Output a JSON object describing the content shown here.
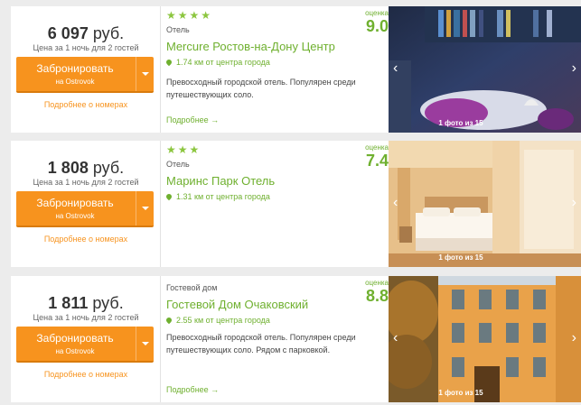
{
  "hotels": [
    {
      "price": "6 097",
      "currency": "руб.",
      "price_note": "Цена за 1 ночь для 2 гостей",
      "book_label": "Забронировать",
      "book_sub": "на Ostrovok",
      "rooms_link": "Подробнее о номерах",
      "stars": "★★★★",
      "type": "Отель",
      "name": "Mercure Ростов-на-Дону Центр",
      "distance": "1.74 км от центра города",
      "description": "Превосходный городской отель. Популярен среди путешествующих соло.",
      "more": "Подробнее →",
      "rating_label": "оценка",
      "rating": "9.0",
      "photo_count": "1 фото из 15"
    },
    {
      "price": "1 808",
      "currency": "руб.",
      "price_note": "Цена за 1 ночь для 2 гостей",
      "book_label": "Забронировать",
      "book_sub": "на Ostrovok",
      "rooms_link": "Подробнее о номерах",
      "stars": "★★★",
      "type": "Отель",
      "name": "Маринс Парк Отель",
      "distance": "1.31 км от центра города",
      "description": "",
      "more": "",
      "rating_label": "оценка",
      "rating": "7.4",
      "photo_count": "1 фото из 15"
    },
    {
      "price": "1 811",
      "currency": "руб.",
      "price_note": "Цена за 1 ночь для 2 гостей",
      "book_label": "Забронировать",
      "book_sub": "на Ostrovok",
      "rooms_link": "Подробнее о номерах",
      "stars": "",
      "type": "Гостевой дом",
      "name": "Гостевой Дом Очаковский",
      "distance": "2.55 км от центра города",
      "description": "Превосходный городской отель. Популярен среди путешествующих соло. Рядом с парковкой.",
      "more": "Подробнее →",
      "rating_label": "оценка",
      "rating": "8.8",
      "photo_count": "1 фото из 15"
    }
  ]
}
